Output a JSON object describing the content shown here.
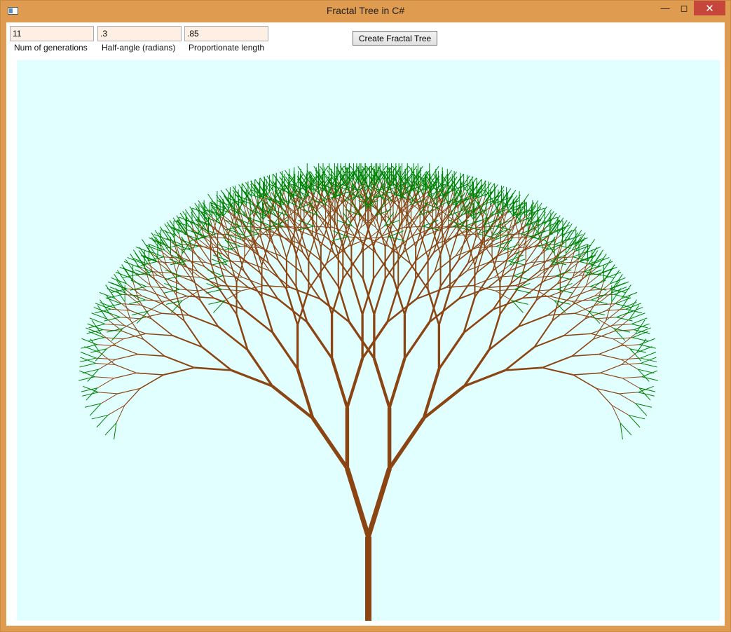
{
  "window": {
    "title": "Fractal Tree in C#",
    "minimize_glyph": "—",
    "maximize_glyph": "◻",
    "close_glyph": "✕"
  },
  "controls": {
    "generations": {
      "value": "11",
      "label": "Num of generations"
    },
    "half_angle": {
      "value": ".3",
      "label": "Half-angle (radians)"
    },
    "proportion": {
      "value": ".85",
      "label": "Proportionate length"
    },
    "create_button_label": "Create Fractal Tree"
  },
  "tree": {
    "generations": 11,
    "half_angle": 0.3,
    "proportion": 0.85,
    "colors": {
      "background": "#e1ffff",
      "branch": "#8b4513",
      "leaf": "#008000"
    }
  }
}
